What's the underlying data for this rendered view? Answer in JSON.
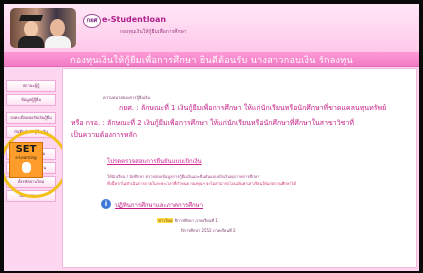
{
  "header": {
    "logo_text": "กยศ",
    "brand": "e-Studentloan",
    "tagline": "กองทุนเงินให้กู้ยืมเพื่อการศึกษา"
  },
  "banner": {
    "text": "กองทุนเงินให้กู้ยืมเพื่อการศึกษา ยินดีต้อนรับ นางสาวกอบเงิน รักลงทุน"
  },
  "sidebar": {
    "items": [
      {
        "label": "สถานะผู้กู้"
      },
      {
        "label": "ข้อมูลผู้กู้ยืม"
      },
      {
        "label": "ลงทะเบียนขอรับเงินกู้ยืม"
      },
      {
        "label": "บันทึกคำขอกู้ยืมเงิน"
      },
      {
        "label": "สรุปยอดการกู้ยืม"
      },
      {
        "label": "ยืนยันแบบเบิกเงิน"
      },
      {
        "label": "ตั้งรหัสผ่านใหม่"
      },
      {
        "label": "ออกจากระบบ"
      }
    ],
    "set_logo": {
      "word": "SET",
      "sub": "e-Learning"
    }
  },
  "content": {
    "header_line": "ความหมายของการกู้ยืมเงิน",
    "definition_a": "กยศ. : ลักษณะที่ 1 เงินกู้ยืมเพื่อการศึกษา ให้แก่นักเรียนหรือนักศึกษาที่ขาดแคลนทุนทรัพย์",
    "definition_b": "หรือ กรอ. : ลักษณะที่ 2 เงินกู้ยืมเพื่อการศึกษา ให้แก่นักเรียนหรือนักศึกษาที่ศึกษาในสาขาวิชาที่",
    "definition_c": "เป็นความต้องการหลัก",
    "link_heading": "โปรดตรวจสอบการยืนยันแบบเบิกเงิน",
    "note1": "ให้นักเรียน / นักศึกษา ตรวจสอบข้อมูลการกู้ยืมเงินและยืนยันแบบเบิกเงินทุกภาคการศึกษา",
    "note2": "ทั้งนี้หากไม่ดำเนินการภายในระยะเวลาที่กำหนด กองทุนฯ จะไม่สามารถโอนเงินค่าเล่าเรียนให้แก่สถานศึกษาได้",
    "info_icon": "i",
    "info_link": "ปฏิทินการศึกษาและภาคการศึกษา",
    "update_tag": "ข่าวใหม่",
    "update_text": "ปีการศึกษา ภาคเรียนที่ 1",
    "year_line": "ปีการศึกษา 2552 ภาคเรียนที่ 2"
  }
}
